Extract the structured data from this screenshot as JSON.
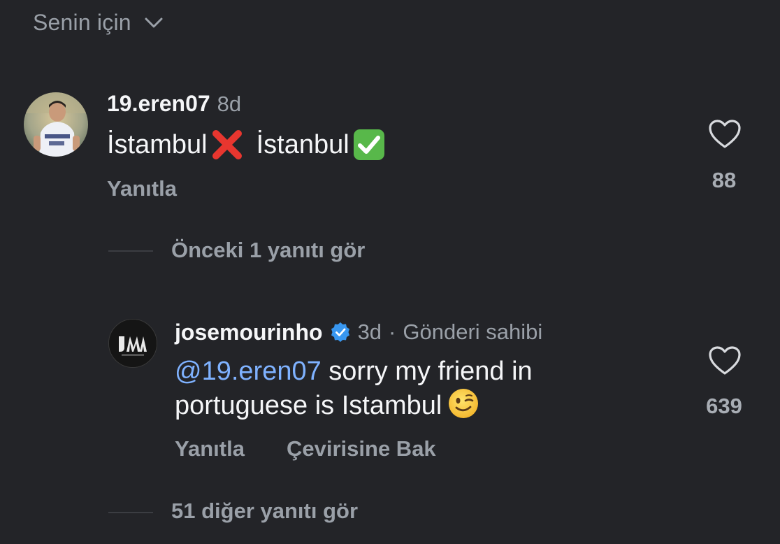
{
  "header": {
    "sort_label": "Senin için",
    "chevron_icon": "chevron-down-icon"
  },
  "comment1": {
    "username": "19.eren07",
    "time": "8d",
    "text_part1": "İstambul",
    "emoji1": "❌",
    "text_part2": "İstanbul",
    "emoji2": "✅",
    "reply_label": "Yanıtla",
    "like_count": "88"
  },
  "previous_replies": {
    "label": "Önceki 1 yanıtı gör"
  },
  "comment2": {
    "username": "josemourinho",
    "verified": true,
    "time": "3d",
    "separator": "·",
    "badge": "Gönderi sahibi",
    "mention": "@19.eren07",
    "text_rest": " sorry my friend in portuguese is Istambul",
    "emoji": "😉",
    "reply_label": "Yanıtla",
    "translate_label": "Çevirisine Bak",
    "like_count": "639"
  },
  "more_replies": {
    "label": "51 diğer yanıtı gör"
  },
  "colors": {
    "background": "#232428",
    "text_primary": "#f5f6f8",
    "text_secondary": "#9aa0a8",
    "mention": "#7fb2ff",
    "verified": "#3897f0"
  }
}
